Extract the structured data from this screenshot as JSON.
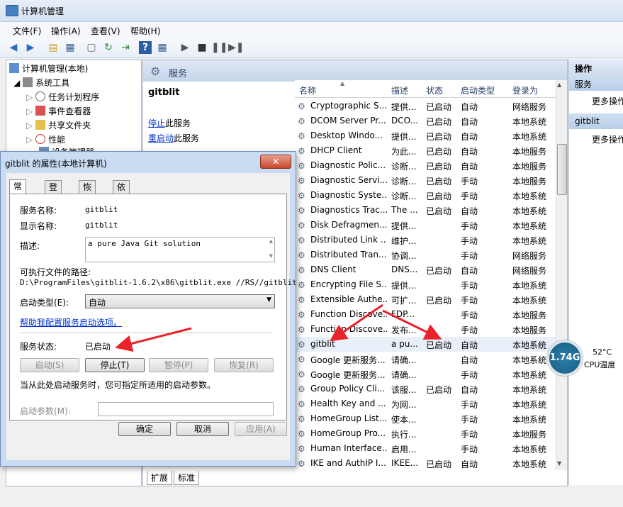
{
  "window": {
    "title": "计算机管理"
  },
  "menu": [
    "文件(F)",
    "操作(A)",
    "查看(V)",
    "帮助(H)"
  ],
  "tree": [
    {
      "label": "计算机管理(本地)"
    },
    {
      "label": "系统工具"
    },
    {
      "label": "任务计划程序"
    },
    {
      "label": "事件查看器"
    },
    {
      "label": "共享文件夹"
    },
    {
      "label": "性能"
    },
    {
      "label": "设备管理器"
    }
  ],
  "services_pane": {
    "header": "服务",
    "selected_name": "gitblit",
    "stop_link": "停止",
    "stop_suffix": "此服务",
    "restart_link": "重启动",
    "restart_suffix": "此服务",
    "columns": [
      "名称",
      "描述",
      "状态",
      "启动类型",
      "登录为"
    ],
    "rows": [
      {
        "name": "Cryptographic S...",
        "desc": "提供...",
        "status": "已启动",
        "start": "自动",
        "logon": "网络服务"
      },
      {
        "name": "DCOM Server Pr...",
        "desc": "DCO...",
        "status": "已启动",
        "start": "自动",
        "logon": "本地系统"
      },
      {
        "name": "Desktop Windo...",
        "desc": "提供...",
        "status": "已启动",
        "start": "自动",
        "logon": "本地系统"
      },
      {
        "name": "DHCP Client",
        "desc": "为此...",
        "status": "已启动",
        "start": "自动",
        "logon": "本地服务"
      },
      {
        "name": "Diagnostic Polic...",
        "desc": "诊断...",
        "status": "已启动",
        "start": "自动",
        "logon": "本地服务"
      },
      {
        "name": "Diagnostic Servi...",
        "desc": "诊断...",
        "status": "已启动",
        "start": "手动",
        "logon": "本地服务"
      },
      {
        "name": "Diagnostic Syste...",
        "desc": "诊断...",
        "status": "已启动",
        "start": "手动",
        "logon": "本地系统"
      },
      {
        "name": "Diagnostics Trac...",
        "desc": "The ...",
        "status": "已启动",
        "start": "自动",
        "logon": "本地系统"
      },
      {
        "name": "Disk Defragmen...",
        "desc": "提供...",
        "status": "",
        "start": "手动",
        "logon": "本地系统"
      },
      {
        "name": "Distributed Link ...",
        "desc": "维护...",
        "status": "",
        "start": "手动",
        "logon": "本地系统"
      },
      {
        "name": "Distributed Tran...",
        "desc": "协调...",
        "status": "",
        "start": "手动",
        "logon": "网络服务"
      },
      {
        "name": "DNS Client",
        "desc": "DNS...",
        "status": "已启动",
        "start": "自动",
        "logon": "网络服务"
      },
      {
        "name": "Encrypting File S...",
        "desc": "提供...",
        "status": "",
        "start": "手动",
        "logon": "本地系统"
      },
      {
        "name": "Extensible Authe...",
        "desc": "可扩...",
        "status": "已启动",
        "start": "手动",
        "logon": "本地系统"
      },
      {
        "name": "Function Discove...",
        "desc": "FDP...",
        "status": "",
        "start": "手动",
        "logon": "本地服务"
      },
      {
        "name": "Function Discove...",
        "desc": "发布...",
        "status": "",
        "start": "手动",
        "logon": "本地服务"
      },
      {
        "name": "gitblit",
        "desc": "a pu...",
        "status": "已启动",
        "start": "自动",
        "logon": "本地系统"
      },
      {
        "name": "Google 更新服务...",
        "desc": "请确...",
        "status": "",
        "start": "自动",
        "logon": "本地系统"
      },
      {
        "name": "Google 更新服务...",
        "desc": "请确...",
        "status": "",
        "start": "手动",
        "logon": "本地系统"
      },
      {
        "name": "Group Policy Cli...",
        "desc": "该服...",
        "status": "已启动",
        "start": "自动",
        "logon": "本地系统"
      },
      {
        "name": "Health Key and ...",
        "desc": "为网...",
        "status": "",
        "start": "手动",
        "logon": "本地系统"
      },
      {
        "name": "HomeGroup List...",
        "desc": "使本...",
        "status": "",
        "start": "手动",
        "logon": "本地系统"
      },
      {
        "name": "HomeGroup Pro...",
        "desc": "执行...",
        "status": "",
        "start": "手动",
        "logon": "本地服务"
      },
      {
        "name": "Human Interface...",
        "desc": "启用...",
        "status": "",
        "start": "手动",
        "logon": "本地系统"
      },
      {
        "name": "IKE and AuthIP I...",
        "desc": "IKEE...",
        "status": "已启动",
        "start": "自动",
        "logon": "本地系统"
      }
    ],
    "bottom_tabs": [
      "扩展",
      "标准"
    ]
  },
  "actions": {
    "header": "操作",
    "section1": "服务",
    "more1": "更多操作",
    "section2": "gitblit",
    "more2": "更多操作"
  },
  "cpu_widget": {
    "value": "1.74G",
    "temp": "52°C",
    "label": "CPU温度"
  },
  "dialog": {
    "title": "gitblit 的属性(本地计算机)",
    "tabs": [
      "常规",
      "登录",
      "恢复",
      "依存关系"
    ],
    "service_name_label": "服务名称:",
    "service_name": "gitblit",
    "display_name_label": "显示名称:",
    "display_name": "gitblit",
    "desc_label": "描述:",
    "desc": "a pure Java Git solution",
    "path_label": "可执行文件的路径:",
    "path": "D:\\ProgramFiles\\gitblit-1.6.2\\x86\\gitblit.exe //RS//gitblit",
    "startup_label": "启动类型(E):",
    "startup_value": "自动",
    "help_link": "帮助我配置服务启动选项。",
    "status_label": "服务状态:",
    "status_value": "已启动",
    "btn_start": "启动(S)",
    "btn_stop": "停止(T)",
    "btn_pause": "暂停(P)",
    "btn_resume": "恢复(R)",
    "hint": "当从此处启动服务时，您可指定所适用的启动参数。",
    "param_label": "启动参数(M):",
    "param_value": "",
    "btn_ok": "确定",
    "btn_cancel": "取消",
    "btn_apply": "应用(A)"
  },
  "colors": {
    "arrow": "#e8232a",
    "link": "#0033cc"
  }
}
